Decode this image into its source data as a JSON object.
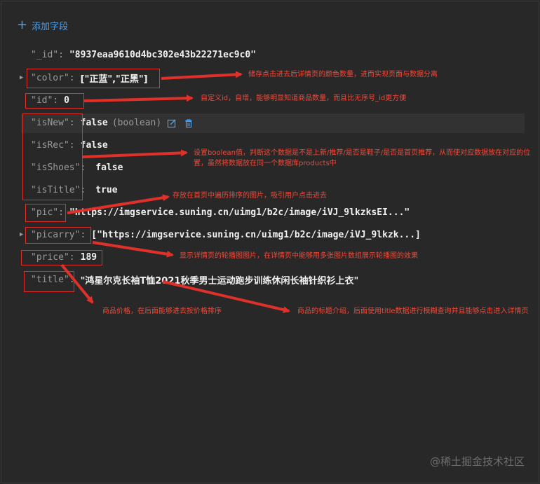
{
  "toolbar": {
    "add_field_label": "添加字段"
  },
  "fields": {
    "_id": {
      "key": "\"_id\"",
      "value": "\"8937eaa9610d4bc302e43b22271ec9c0\""
    },
    "color": {
      "key": "\"color\"",
      "value": "[\"正蓝\",\"正黑\"]"
    },
    "id": {
      "key": "\"id\"",
      "value": "0"
    },
    "isNew": {
      "key": "\"isNew\"",
      "value": "false",
      "type": "(boolean)"
    },
    "isRec": {
      "key": "\"isRec\"",
      "value": "false"
    },
    "isShoes": {
      "key": "\"isShoes\"",
      "value": "false"
    },
    "isTitle": {
      "key": "\"isTitle\"",
      "value": "true"
    },
    "pic": {
      "key": "\"pic\"",
      "value": "\"https://imgservice.suning.cn/uimg1/b2c/image/iVJ_9lkzksEI...\""
    },
    "picarry": {
      "key": "\"picarry\"",
      "value": "[\"https://imgservice.suning.cn/uimg1/b2c/image/iVJ_9lkzk...]"
    },
    "price": {
      "key": "\"price\"",
      "value": "189"
    },
    "title": {
      "key": "\"title\"",
      "value": "\"鸿星尔克长袖T恤2021秋季男士运动跑步训练休闲长袖针织衫上衣\""
    }
  },
  "annotations": {
    "color": "储存点击进去后详情页的颜色数量，进而实现页面与数据分离",
    "id": "自定义id，自增，能够明显知道商品数量，而且比无序号_id更方便",
    "boolean": "设置boolean值，判断这个数据是不是上新/推荐/是否是鞋子/是否是首页推荐，从而使对应数据放在对应的位置，虽然将数据放在同一个数据库products中",
    "pic": "存放在首页中遍历排序的图片，吸引用户点击进去",
    "picarry": "显示详情页的轮播图图片，在详情页中能够用多张图片数组展示轮播图的效果",
    "price": "商品价格，在后面能够进去按价格排序",
    "title": "商品的标题介绍，后面使用title数据进行模糊查询并且能够点击进入详情页"
  },
  "watermark": "@稀土掘金技术社区",
  "colors": {
    "accent": "#4f9fe6",
    "annotation": "#f04a3a",
    "background": "#282828"
  },
  "icons": [
    "plus-icon",
    "expand-arrow-icon",
    "edit-icon",
    "trash-icon"
  ]
}
